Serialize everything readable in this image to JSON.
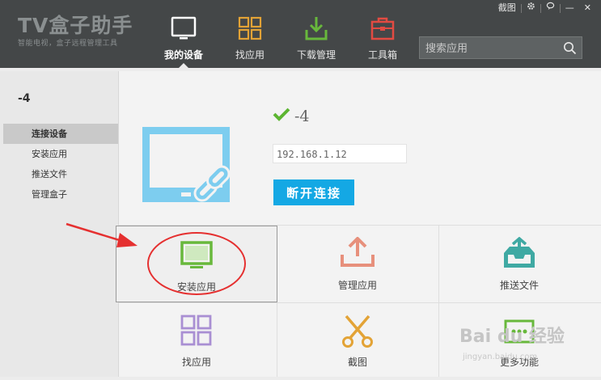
{
  "app": {
    "title": "TV盒子助手",
    "subtitle": "智能电视，盒子远程管理工具"
  },
  "window_controls": {
    "screenshot_label": "截图",
    "settings_icon": "gear-icon",
    "feedback_icon": "chat-icon",
    "minimize_label": "—",
    "close_label": "✕"
  },
  "nav": {
    "items": [
      {
        "label": "我的设备",
        "icon": "tv-icon",
        "active": true
      },
      {
        "label": "找应用",
        "icon": "grid-icon"
      },
      {
        "label": "下载管理",
        "icon": "download-icon"
      },
      {
        "label": "工具箱",
        "icon": "toolbox-icon"
      }
    ]
  },
  "search": {
    "placeholder": "搜索应用",
    "icon": "search-icon"
  },
  "sidebar": {
    "device_title": "-4",
    "items": [
      {
        "label": "连接设备",
        "active": true
      },
      {
        "label": "安装应用"
      },
      {
        "label": "推送文件"
      },
      {
        "label": "管理盒子"
      }
    ]
  },
  "device": {
    "status_icon": "check-icon",
    "name": "-4",
    "ip": "192.168.1.12",
    "disconnect_label": "断开连接"
  },
  "tiles": [
    {
      "label": "安装应用",
      "icon": "install-app-icon"
    },
    {
      "label": "管理应用",
      "icon": "upload-icon"
    },
    {
      "label": "推送文件",
      "icon": "inbox-icon"
    },
    {
      "label": "找应用",
      "icon": "grid-icon"
    },
    {
      "label": "截图",
      "icon": "scissors-icon"
    },
    {
      "label": "更多功能",
      "icon": "more-icon"
    }
  ],
  "watermark": {
    "text": "Bai du 经验",
    "url": "jingyan.baidu.com"
  },
  "colors": {
    "header_bg": "#444748",
    "accent_blue": "#14a8e4",
    "tv_blue": "#7dcdef",
    "green": "#68b83c",
    "orange": "#e3a336",
    "red": "#e24b42",
    "purple": "#a98fd3",
    "salmon": "#e7907c",
    "teal": "#3fa9a3",
    "annotation_red": "#e53030"
  }
}
